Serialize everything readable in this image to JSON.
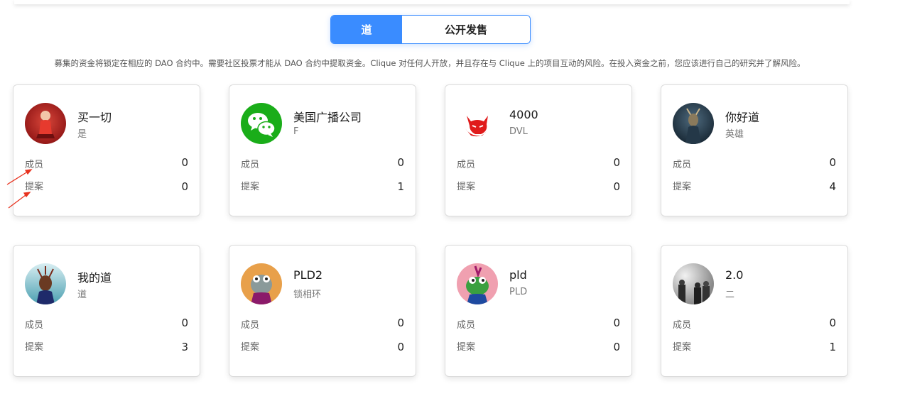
{
  "tabs": [
    {
      "label": "道",
      "active": true
    },
    {
      "label": "公开发售",
      "active": false
    }
  ],
  "disclaimer": "募集的资金将锁定在相应的 DAO 合约中。需要社区投票才能从 DAO 合约中提取资金。Clique 对任何人开放，并且存在与 Clique 上的项目互动的风险。在投入资金之前，您应该进行自己的研究并了解风险。",
  "stat_labels": {
    "members": "成员",
    "proposals": "提案"
  },
  "cards": [
    {
      "name": "买一切",
      "symbol": "是",
      "members": "0",
      "proposals": "0",
      "avatar": "red-figure-avatar"
    },
    {
      "name": "美国广播公司",
      "symbol": "F",
      "members": "0",
      "proposals": "1",
      "avatar": "wechat-logo-avatar"
    },
    {
      "name": "4000",
      "symbol": "DVL",
      "members": "0",
      "proposals": "0",
      "avatar": "red-devil-avatar"
    },
    {
      "name": "你好道",
      "symbol": "英雄",
      "members": "0",
      "proposals": "4",
      "avatar": "dark-figure-avatar"
    },
    {
      "name": "我的道",
      "symbol": "道",
      "members": "0",
      "proposals": "3",
      "avatar": "masked-figure-avatar"
    },
    {
      "name": "PLD2",
      "symbol": "锁相环",
      "members": "0",
      "proposals": "0",
      "avatar": "frog-orange-avatar"
    },
    {
      "name": "pld",
      "symbol": "PLD",
      "members": "0",
      "proposals": "0",
      "avatar": "frog-pink-avatar"
    },
    {
      "name": "2.0",
      "symbol": "二",
      "members": "0",
      "proposals": "1",
      "avatar": "photo-group-avatar"
    }
  ],
  "colors": {
    "accent": "#3a8cff",
    "annotation_arrow": "#e8321e"
  }
}
